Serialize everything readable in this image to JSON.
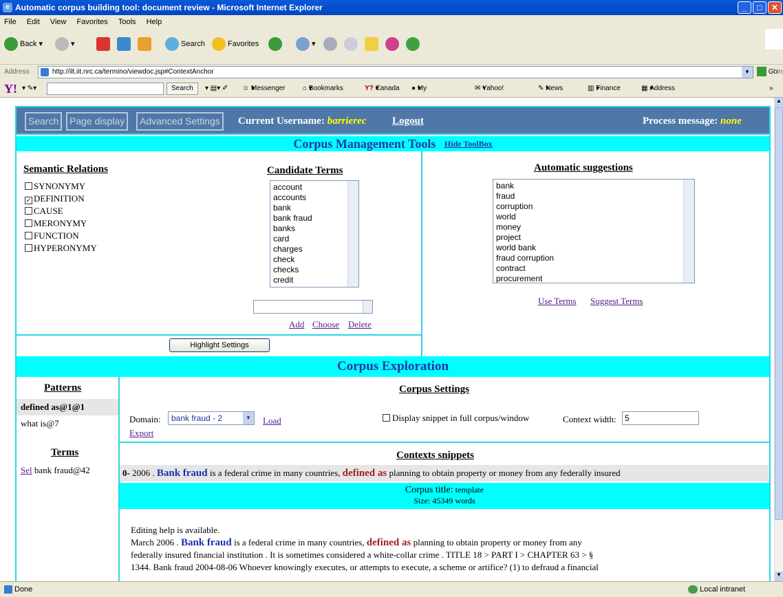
{
  "window": {
    "title": "Automatic corpus building tool: document review - Microsoft Internet Explorer"
  },
  "menu": [
    "File",
    "Edit",
    "View",
    "Favorites",
    "Tools",
    "Help"
  ],
  "toolbar": {
    "back": "Back",
    "search": "Search",
    "favorites": "Favorites"
  },
  "address": {
    "label": "Address",
    "url": "http://ilt.iit.nrc.ca/termino/viewdoc.jsp#ContextAnchor",
    "go": "Go",
    "links": "Links"
  },
  "yahoo": {
    "search": "Search",
    "items": [
      "Messenger",
      "Bookmarks",
      "Canada",
      "My Yahoo!",
      "Yahoo! Mail",
      "News",
      "Finance",
      "Address Book"
    ]
  },
  "nav": {
    "search": "Search",
    "page_display": "Page display",
    "advanced": "Advanced Settings",
    "username_label": "Current Username:",
    "username": "barrierec",
    "logout": "Logout",
    "process_label": "Process message:",
    "process_value": "none"
  },
  "tools": {
    "title": "Corpus Management Tools",
    "hide": "Hide ToolBox",
    "semantic_header": "Semantic Relations",
    "relations": [
      {
        "label": "SYNONYMY",
        "checked": false
      },
      {
        "label": "DEFINITION",
        "checked": true
      },
      {
        "label": "CAUSE",
        "checked": false
      },
      {
        "label": "MERONYMY",
        "checked": false
      },
      {
        "label": "FUNCTION",
        "checked": false
      },
      {
        "label": "HYPERONYMY",
        "checked": false
      }
    ],
    "candidate_header": "Candidate Terms",
    "candidates": [
      "account",
      "accounts",
      "bank",
      "bank fraud",
      "banks",
      "card",
      "charges",
      "check",
      "checks",
      "credit"
    ],
    "add": "Add",
    "choose": "Choose",
    "delete": "Delete",
    "highlight": "Highlight Settings",
    "auto_header": "Automatic suggestions",
    "suggestions": [
      "bank",
      "fraud",
      "corruption",
      "world",
      "money",
      "project",
      "world bank",
      "fraud corruption",
      "contract",
      "procurement"
    ],
    "use_terms": "Use Terms",
    "suggest_terms": "Suggest Terms"
  },
  "exploration": {
    "title": "Corpus Exploration",
    "patterns_header": "Patterns",
    "patterns": [
      "defined as@1@1",
      "what is@7"
    ],
    "terms_header": "Terms",
    "sel": "Sel",
    "term": "bank fraud@42",
    "settings_header": "Corpus Settings",
    "domain_label": "Domain:",
    "domain_value": "bank fraud - 2",
    "load": "Load",
    "export": "Export",
    "display_full": "Display snippet in full corpus/window",
    "context_label": "Context width:",
    "context_value": "5",
    "snippets_header": "Contexts snippets",
    "snippet": {
      "num": "0-",
      "pre": "2006 .",
      "term": "Bank fraud",
      "mid": "is a federal crime in many countries,",
      "pattern": "defined as",
      "post": "planning to obtain property or money from any federally insured"
    },
    "corpus_title_label": "Corpus title:",
    "corpus_title": "template",
    "size": "Size: 45349 words",
    "doc": {
      "line1": "Editing help is available.",
      "l2pre": "March 2006 .",
      "l2term": "Bank fraud",
      "l2mid": "is a federal crime in many countries,",
      "l2pattern": "defined as",
      "l2post": "planning to obtain property or money from any",
      "line3": "federally insured financial institution . It is sometimes considered a white-collar crime . TITLE 18 > PART I > CHAPTER 63 > §",
      "line4": "1344. Bank fraud 2004-08-06 Whoever knowingly executes, or attempts to execute, a scheme or artifice? (1) to defraud a financial"
    }
  },
  "status": {
    "left": "Done",
    "right": "Local intranet"
  }
}
